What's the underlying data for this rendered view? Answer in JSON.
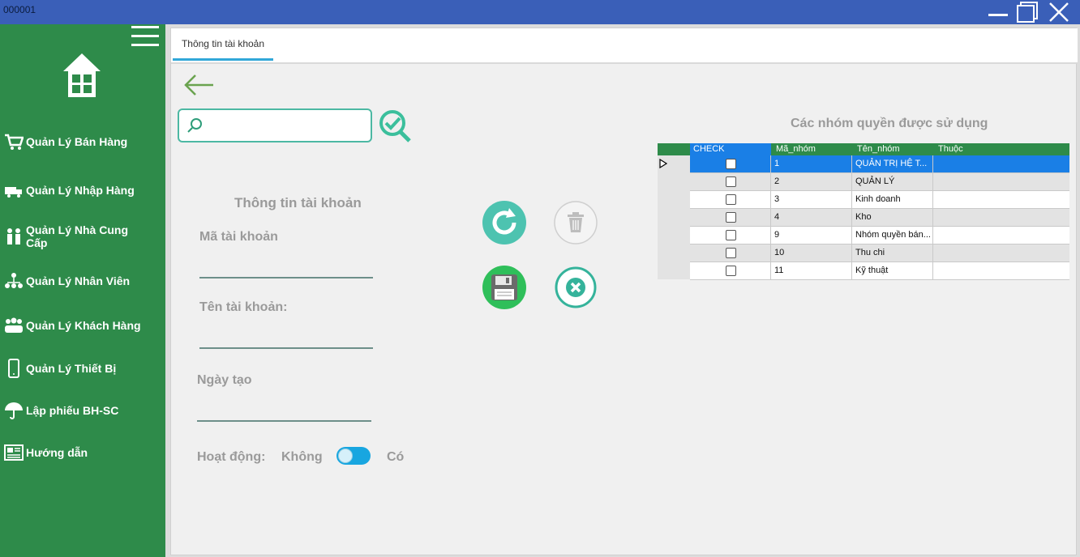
{
  "window": {
    "title": "000001"
  },
  "sidebar": {
    "items": [
      {
        "label": "Quản Lý Bán Hàng",
        "icon": "cart-icon"
      },
      {
        "label": "Quản Lý Nhập Hàng",
        "icon": "truck-icon"
      },
      {
        "label": "Quản Lý Nhà Cung Cấp",
        "icon": "supplier-icon"
      },
      {
        "label": "Quản Lý Nhân Viên",
        "icon": "org-chart-icon"
      },
      {
        "label": "Quản Lý Khách Hàng",
        "icon": "customers-icon"
      },
      {
        "label": "Quản Lý Thiết Bị",
        "icon": "phone-icon"
      },
      {
        "label": "Lập phiếu BH-SC",
        "icon": "umbrella-icon"
      },
      {
        "label": "Hướng dẫn",
        "icon": "newspaper-icon"
      }
    ]
  },
  "tabs": [
    {
      "label": "Thông tin tài khoản"
    }
  ],
  "form": {
    "title": "Thông tin tài khoản",
    "account_id_label": "Mã tài khoản",
    "account_name_label": "Tên tài khoản:",
    "created_date_label": "Ngày tạo",
    "active_label": "Hoạt động:",
    "toggle_off_label": "Không",
    "toggle_on_label": "Có",
    "search_value": ""
  },
  "grid": {
    "title": "Các nhóm quyền được sử dụng",
    "columns": [
      "CHECK",
      "Mã_nhóm",
      "Tên_nhóm",
      "Thuộc"
    ],
    "rows": [
      {
        "id": "1",
        "name": "QUẢN TRỊ HỆ T...",
        "belongs": ""
      },
      {
        "id": "2",
        "name": "QUẢN LÝ",
        "belongs": ""
      },
      {
        "id": "3",
        "name": "Kinh doanh",
        "belongs": ""
      },
      {
        "id": "4",
        "name": "Kho",
        "belongs": ""
      },
      {
        "id": "9",
        "name": "Nhóm quyền bán...",
        "belongs": ""
      },
      {
        "id": "10",
        "name": "Thu chi",
        "belongs": ""
      },
      {
        "id": "11",
        "name": "Kỹ thuật",
        "belongs": ""
      }
    ]
  },
  "colors": {
    "sidebar": "#2e8b4a",
    "titlebar": "#3a5fb8",
    "accent": "#4cb8a3",
    "selected_row": "#1a7fe6"
  }
}
